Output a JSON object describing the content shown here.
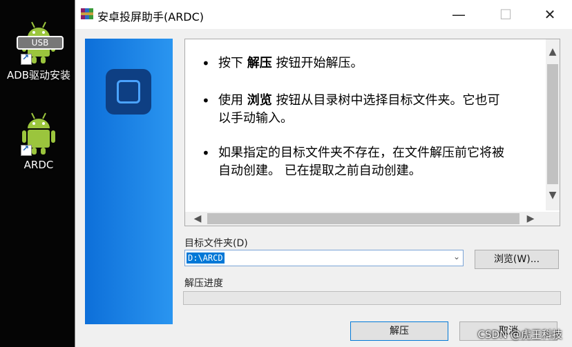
{
  "desktop": {
    "icons": [
      {
        "label": "ADB驱动安装",
        "badge": "USB",
        "icon": "android-usb-icon"
      },
      {
        "label": "ARDC",
        "icon": "android-icon"
      }
    ],
    "android_color": "#9bc53d"
  },
  "window": {
    "title": "安卓投屏助手(ARDC)",
    "controls": {
      "minimize": "—",
      "maximize": "☐",
      "close": "✕"
    },
    "info": {
      "bullets": [
        {
          "pre": "按下 ",
          "bold": "解压",
          "post": " 按钮开始解压。"
        },
        {
          "pre": "使用 ",
          "bold": "浏览",
          "post": " 按钮从目录树中选择目标文件夹。它也可以手动输入。"
        },
        {
          "pre": "如果指定的目标文件夹不存在，在文件解压前它将被自动创建。 已在提取之前自动创建。",
          "bold": "",
          "post": ""
        }
      ]
    },
    "dest_label": "目标文件夹(D)",
    "dest_value": "D:\\ARCD",
    "browse_label": "浏览(W)...",
    "progress_label": "解压进度",
    "progress_value": 0,
    "extract_label": "解压",
    "cancel_label": "取消"
  },
  "watermark": "CSDN @虎王科技",
  "colors": {
    "banner": "#1a8ae6",
    "selection": "#0078d7"
  }
}
